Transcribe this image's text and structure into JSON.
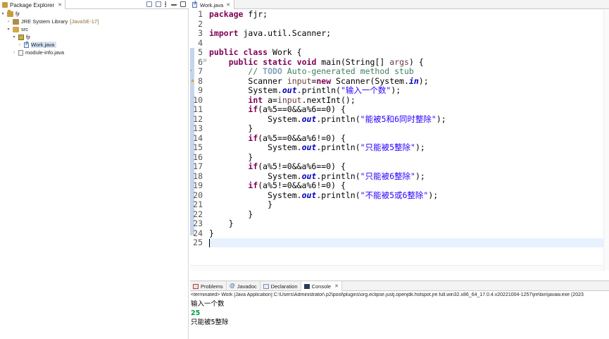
{
  "explorer": {
    "tab_label": "Package Explorer",
    "close_glyph": "✕",
    "tree": [
      {
        "label": "fjr",
        "kind": "project",
        "expanded": true
      },
      {
        "label": "JRE System Library",
        "suffix": "[JavaSE-17]",
        "kind": "lib",
        "expanded": false
      },
      {
        "label": "src",
        "kind": "src",
        "expanded": true
      },
      {
        "label": "fjr",
        "kind": "package",
        "expanded": true
      },
      {
        "label": "Work.java",
        "kind": "java",
        "selected": true,
        "expanded": false
      },
      {
        "label": "module-info.java",
        "kind": "modinfo",
        "expanded": false
      }
    ]
  },
  "editor": {
    "tab_label": "Work.java",
    "close_glyph": "✕",
    "line_numbers": [
      "1",
      "2",
      "3",
      "4",
      "5",
      "6",
      "7",
      "8",
      "9",
      "10",
      "11",
      "12",
      "13",
      "14",
      "15",
      "16",
      "17",
      "18",
      "19",
      "20",
      "21",
      "22",
      "23",
      "24",
      "25"
    ],
    "code": {
      "l1_kw": "package",
      "l1_rest": " fjr;",
      "l3_kw": "import",
      "l3_rest": " java.util.Scanner;",
      "l5_kw1": "public",
      "l5_kw2": "class",
      "l5_rest": " Work {",
      "l6_kw1": "public",
      "l6_kw2": "static",
      "l6_kw3": "void",
      "l6_mid": " main(String[] ",
      "l6_param": "args",
      "l6_end": ") {",
      "l7_comment_a": "// ",
      "l7_todo": "TODO",
      "l7_comment_b": " Auto-generated method stub",
      "l8_a": "Scanner ",
      "l8_var": "input",
      "l8_eq": "=",
      "l8_kw": "new",
      "l8_b": " Scanner(System.",
      "l8_fld": "in",
      "l8_c": ");",
      "l9_a": "System.",
      "l9_fld": "out",
      "l9_b": ".println(",
      "l9_str": "\"输入一个数\"",
      "l9_c": ");",
      "l10_kw": "int",
      "l10_a": " a=",
      "l10_var": "input",
      "l10_b": ".nextInt();",
      "l11_kw": "if",
      "l11_rest": "(a%5==0&&a%6==0) {",
      "l12_a": "System.",
      "l12_fld": "out",
      "l12_b": ".println(",
      "l12_str": "\"能被5和6同时整除\"",
      "l12_c": ");",
      "l13": "}",
      "l14_kw": "if",
      "l14_rest": "(a%5==0&&a%6!=0) {",
      "l15_a": "System.",
      "l15_fld": "out",
      "l15_b": ".println(",
      "l15_str": "\"只能被5整除\"",
      "l15_c": ");",
      "l16": "}",
      "l17_kw": "if",
      "l17_rest": "(a%5!=0&&a%6==0) {",
      "l18_a": "System.",
      "l18_fld": "out",
      "l18_b": ".println(",
      "l18_str": "\"只能被6整除\"",
      "l18_c": ");",
      "l19_kw": "if",
      "l19_rest": "(a%5!=0&&a%6!=0) {",
      "l20_a": "System.",
      "l20_fld": "out",
      "l20_b": ".println(",
      "l20_str": "\"不能被5或6整除\"",
      "l20_c": ");",
      "l21": "}",
      "l22": "}",
      "l23": "}",
      "l24": "}",
      "l25": ""
    }
  },
  "console": {
    "tabs": [
      "Problems",
      "Javadoc",
      "Declaration",
      "Console"
    ],
    "active_tab": "Console",
    "close_glyph": "✕",
    "terminated_line": "<terminated> Work [Java Application] C:\\Users\\Administrator\\.p2\\pool\\plugins\\org.eclipse.justj.openjdk.hotspot.jre.full.win32.x86_64_17.0.4.v20221004-1257\\jre\\bin\\javaw.exe  (2023",
    "output": [
      "输入一个数",
      "25",
      "只能被5整除"
    ]
  },
  "colors": {
    "keyword": "#7f0055",
    "comment": "#3f7f5f",
    "string": "#2a00ff",
    "field": "#0000c0",
    "console_input": "#009e42",
    "current_line": "#e8f2fe",
    "selection": "#d6e3f5"
  }
}
